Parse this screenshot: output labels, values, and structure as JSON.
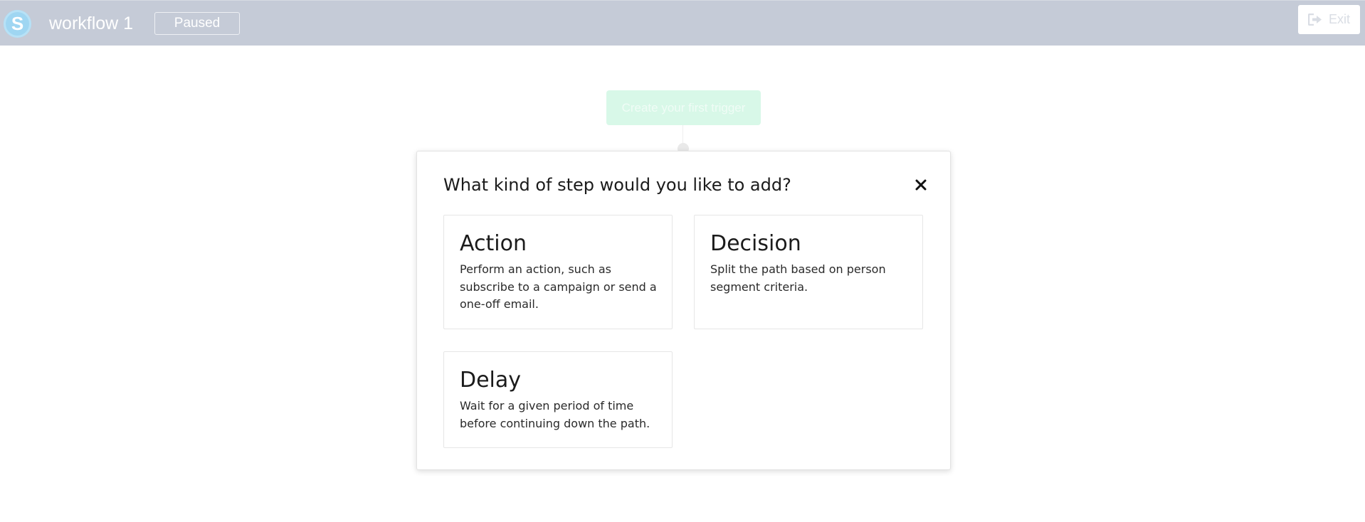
{
  "header": {
    "logo_letter": "S",
    "workflow_title": "workflow 1",
    "status": "Paused",
    "exit_label": "Exit",
    "exit_icon": "sign-out-icon"
  },
  "canvas": {
    "trigger_label": "Create your first trigger"
  },
  "modal": {
    "title": "What kind of step would you like to add?",
    "close_icon": "close-icon",
    "options": [
      {
        "title": "Action",
        "description": "Perform an action, such as subscribe to a campaign or send a one-off email."
      },
      {
        "title": "Decision",
        "description": "Split the path based on person segment criteria."
      },
      {
        "title": "Delay",
        "description": "Wait for a given period of time before continuing down the path."
      }
    ]
  },
  "colors": {
    "topbar_bg": "#c5cbd7",
    "logo_bg": "#9fd6f2",
    "trigger_bg": "#d8f8e8",
    "modal_bg": "#ffffff",
    "text_dark": "#1b1b1b"
  }
}
